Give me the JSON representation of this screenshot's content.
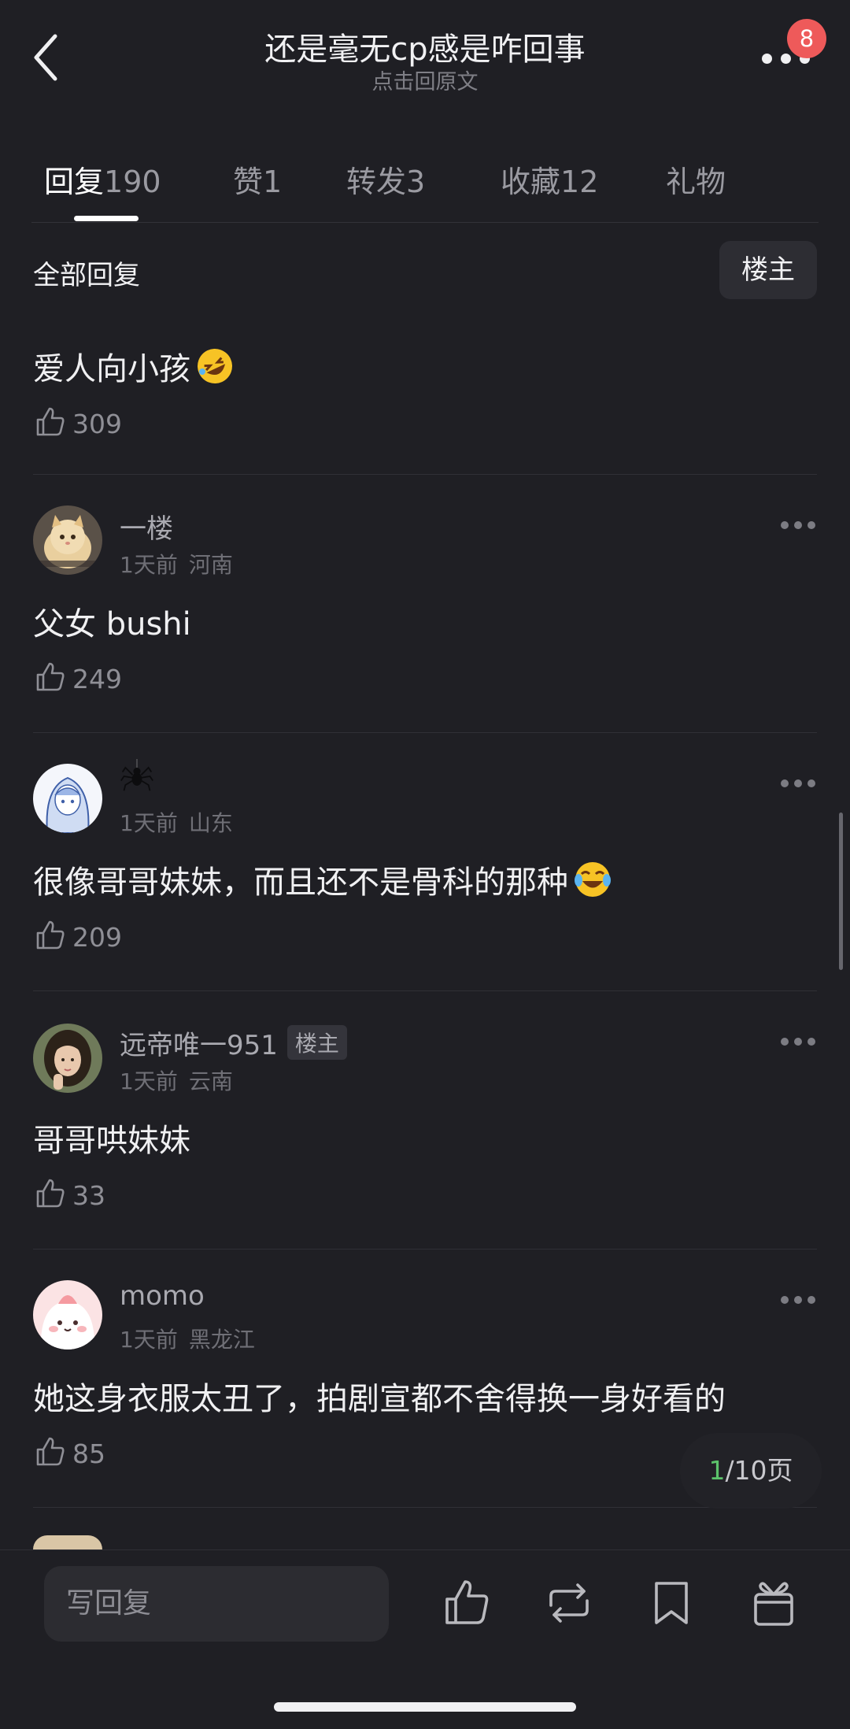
{
  "header": {
    "title": "还是毫无cp感是咋回事",
    "subtitle": "点击回原文",
    "badge": "8"
  },
  "tabs": [
    {
      "label": "回复",
      "count": "190"
    },
    {
      "label": "赞",
      "count": "1"
    },
    {
      "label": "转发",
      "count": "3"
    },
    {
      "label": "收藏",
      "count": "12"
    },
    {
      "label": "礼物",
      "count": ""
    }
  ],
  "filter": {
    "label": "全部回复",
    "op_button": "楼主"
  },
  "comments": [
    {
      "user": "",
      "time": "",
      "location": "",
      "text": "爱人向小孩",
      "likes": "309"
    },
    {
      "user": "一楼",
      "time": "1天前",
      "location": "河南",
      "text": "父女 bushi",
      "likes": "249"
    },
    {
      "user": "",
      "time": "1天前",
      "location": "山东",
      "text": "很像哥哥妹妹，而且还不是骨科的那种",
      "likes": "209"
    },
    {
      "user": "远帝唯一951",
      "tag": "楼主",
      "time": "1天前",
      "location": "云南",
      "text": "哥哥哄妹妹",
      "likes": "33"
    },
    {
      "user": "momo",
      "time": "1天前",
      "location": "黑龙江",
      "text": "她这身衣服太丑了，拍剧宣都不舍得换一身好看的",
      "likes": "85"
    }
  ],
  "pagination": {
    "current": "1",
    "total": "/10页"
  },
  "bottom_bar": {
    "reply_placeholder": "写回复"
  },
  "icons": [
    "back-icon",
    "more-icon",
    "thumb-up-icon",
    "repost-icon",
    "bookmark-icon",
    "gift-icon",
    "rofl-emoji",
    "tears-of-joy-emoji",
    "spider-icon"
  ],
  "colors": {
    "background": "#1f1f24",
    "badge": "#ee5a5a",
    "page_current": "#5cc36b"
  }
}
